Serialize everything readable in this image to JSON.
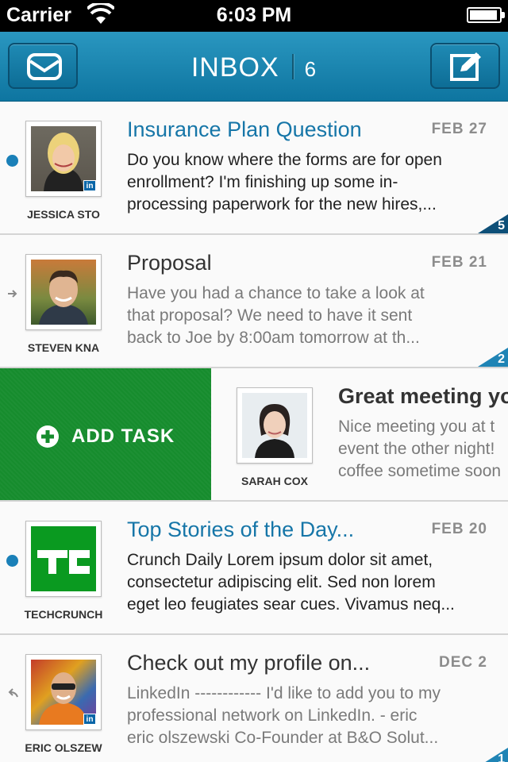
{
  "status_bar": {
    "carrier": "Carrier",
    "time": "6:03 PM"
  },
  "nav": {
    "title": "INBOX",
    "count": "6"
  },
  "swipe_action": {
    "label": "ADD TASK"
  },
  "colors": {
    "accent": "#1676a8",
    "nav": "#1a85b0",
    "add_task": "#168c2d",
    "unread_dot": "#1a80b8"
  },
  "messages": [
    {
      "sender": "JESSICA STO",
      "subject": "Insurance Plan Question",
      "date": "FEB 27",
      "preview": "Do you know where the forms are for open\nenrollment? I'm finishing up some in-\nprocessing paperwork for the new hires,...",
      "thread_count": "5",
      "indicator": "unread-dot",
      "linkedin": true,
      "unread": true
    },
    {
      "sender": "STEVEN KNA",
      "subject": "Proposal",
      "date": "FEB 21",
      "preview": "Have you had a chance to take a look at\nthat proposal? We need to have it sent\nback to Joe by 8:00am tomorrow at th...",
      "thread_count": "2",
      "indicator": "forward-icon",
      "linkedin": false,
      "unread": false
    },
    {
      "sender": "SARAH COX",
      "subject": "Great meeting yo",
      "date": "",
      "preview": "Nice meeting you at t\nevent the other night!\ncoffee sometime soon",
      "thread_count": "",
      "indicator": "",
      "linkedin": false,
      "unread": false
    },
    {
      "sender": "TECHCRUNCH",
      "subject": "Top Stories of the Day...",
      "date": "FEB 20",
      "preview": "Crunch Daily Lorem ipsum dolor sit amet,\nconsectetur adipiscing elit. Sed non lorem\neget leo feugiates sear cues. Vivamus neq...",
      "thread_count": "",
      "indicator": "unread-dot",
      "linkedin": false,
      "unread": true
    },
    {
      "sender": "ERIC OLSZEW",
      "subject": "Check out my profile on...",
      "date": "DEC 2",
      "preview": "LinkedIn ------------ I'd like to add you to my\nprofessional network on LinkedIn. - eric\neric olszewski Co-Founder at B&O Solut...",
      "thread_count": "1",
      "indicator": "reply-icon",
      "linkedin": true,
      "unread": false
    }
  ]
}
